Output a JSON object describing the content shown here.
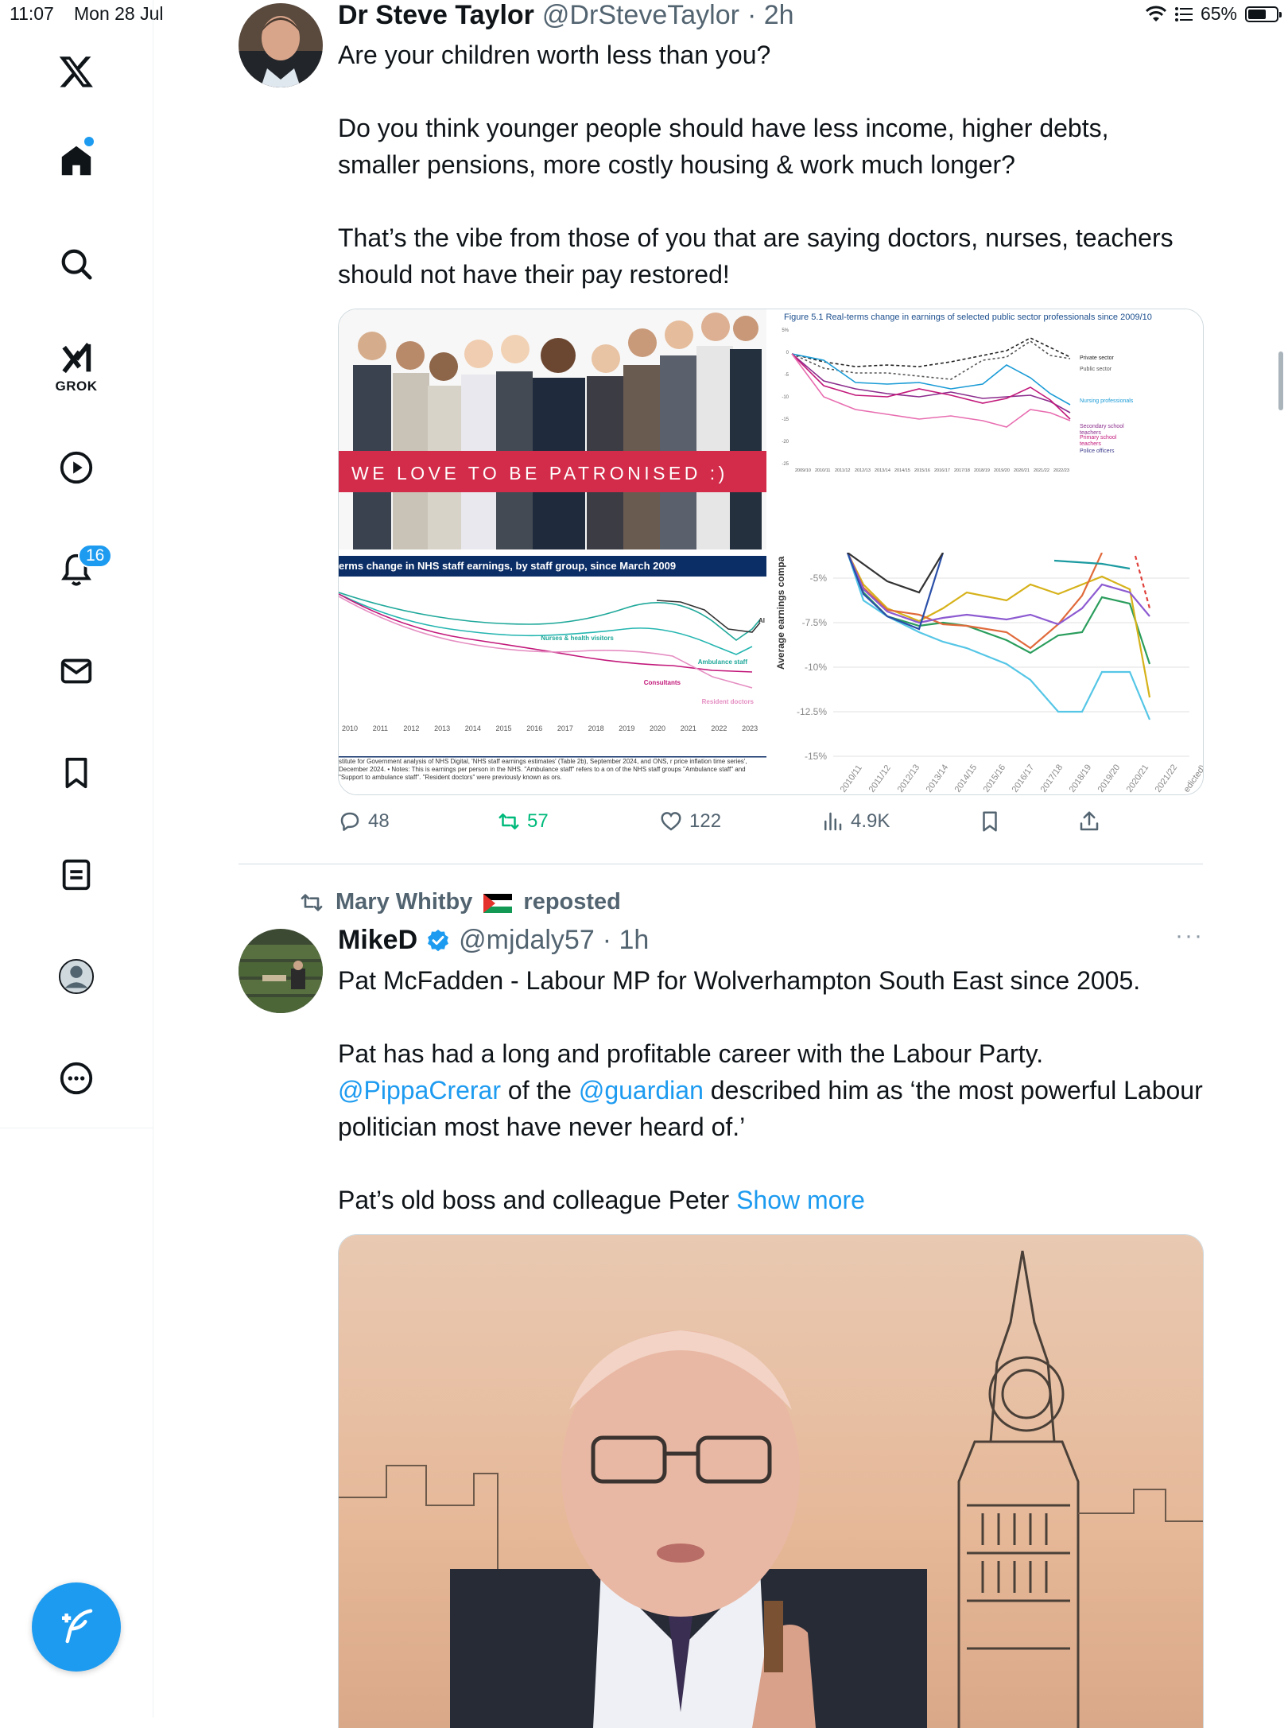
{
  "status_bar": {
    "time": "11:07",
    "date": "Mon 28 Jul",
    "battery": "65%",
    "battery_level": 0.65
  },
  "sidebar": {
    "items": [
      {
        "name": "home",
        "icon": "home-icon"
      },
      {
        "name": "explore",
        "icon": "search-icon"
      },
      {
        "name": "grok",
        "icon": "grok-icon",
        "label": "GROK"
      },
      {
        "name": "video",
        "icon": "play-icon"
      },
      {
        "name": "notifications",
        "icon": "bell-icon",
        "badge": "16"
      },
      {
        "name": "messages",
        "icon": "mail-icon"
      },
      {
        "name": "bookmarks",
        "icon": "bookmark-icon"
      },
      {
        "name": "articles",
        "icon": "document-icon"
      },
      {
        "name": "profile",
        "icon": "profile-icon"
      },
      {
        "name": "more",
        "icon": "more-icon"
      }
    ],
    "compose_icon": "compose-icon"
  },
  "post1": {
    "author": "Dr Steve Taylor",
    "handle": "@DrSteveTaylor",
    "time": "· 2h",
    "text": "Are your children worth less than you?\n\nDo you think younger people should have less income, higher debts, smaller pensions, more costly housing & work much longer?\n\nThat’s the vibe from those of you that are saying doctors, nurses, teachers should not have their pay restored!",
    "media": {
      "banner_text": "WE LOVE TO BE PATRONISED :)",
      "fig1_title": "Figure 5.1 Real-terms change in earnings of selected public sector professionals since 2009/10",
      "fig1_legend": [
        "Private sector",
        "Public sector",
        "Nursing professionals",
        "Secondary school teachers",
        "Primary school teachers",
        "Police officers"
      ],
      "fig1_yticks": [
        "5%",
        "0",
        "-5",
        "-10",
        "-15",
        "-20",
        "-25"
      ],
      "fig1_xticks": [
        "2009/10",
        "2010/11",
        "2011/12",
        "2012/13",
        "2013/14",
        "2014/15",
        "2015/16",
        "2016/17",
        "2017/18",
        "2018/19",
        "2019/20",
        "2020/21",
        "2021/22",
        "2022/23"
      ],
      "fig2_title": "erms change in NHS staff earnings, by staff group, since March 2009",
      "fig2_labels": [
        "Nurses & health visitors",
        "Ambulance staff",
        "Consultants",
        "Resident doctors",
        "Al"
      ],
      "fig2_xticks": [
        "2010",
        "2011",
        "2012",
        "2013",
        "2014",
        "2015",
        "2016",
        "2017",
        "2018",
        "2019",
        "2020",
        "2021",
        "2022",
        "2023"
      ],
      "fig2_note": "stitute for Government analysis of NHS Digital, 'NHS staff earnings estimates' (Table 2b), September 2024, and ONS, r price inflation time series', December 2024. • Notes: This is earnings per person in the NHS. \"Ambulance staff\" refers to a on of the NHS staff groups \"Ambulance staff\" and \"Support to ambulance staff\". \"Resident doctors\" were previously known as ors.",
      "fig3_ylabel": "Average earnings compa",
      "fig3_yticks": [
        "-5%",
        "-7.5%",
        "-10%",
        "-12.5%",
        "-15%"
      ],
      "fig3_xticks": [
        "2010/11",
        "2011/12",
        "2012/13",
        "2013/14",
        "2014/15",
        "2015/16",
        "2016/17",
        "2017/18",
        "2018/19",
        "2019/20",
        "2020/21",
        "2021/22",
        "edicted)"
      ]
    },
    "stats": {
      "replies": "48",
      "reposts": "57",
      "likes": "122",
      "views": "4.9K"
    }
  },
  "post2": {
    "reposted_by": "Mary Whitby",
    "reposted_label": "reposted",
    "author": "MikeD",
    "handle": "@mjdaly57",
    "time": "· 1h",
    "more": "···",
    "line1": "Pat McFadden - Labour MP for Wolverhampton South East since 2005.",
    "line2": "Pat has had a long and profitable career with the Labour Party.",
    "mention1": "@PippaCrerar",
    "of_the": " of the ",
    "mention2": "@guardian",
    "line3": " described him as ‘the most powerful Labour politician most have never heard of.’",
    "line4": "Pat’s old boss and colleague Peter ",
    "show_more": "Show more"
  },
  "colors": {
    "accent": "#1d9bf0",
    "repost_green": "#00ba7c",
    "muted": "#536471"
  }
}
